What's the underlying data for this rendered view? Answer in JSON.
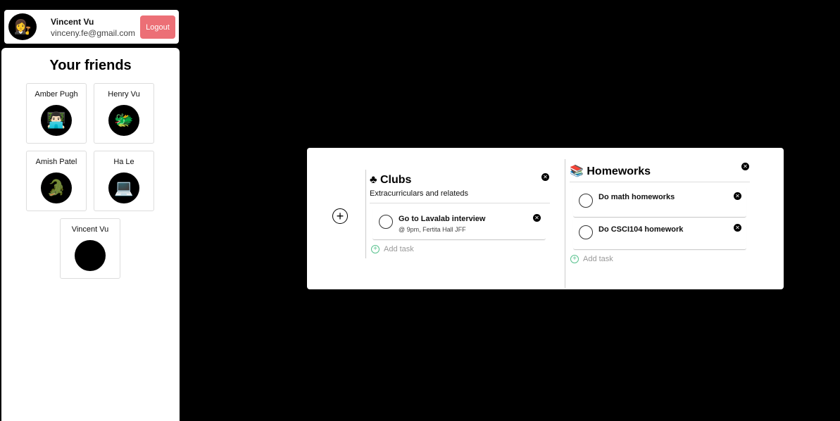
{
  "user": {
    "name": "Vincent Vu",
    "email": "vinceny.fe@gmail.com",
    "avatar": "👩‍⚖️",
    "logout_label": "Logout"
  },
  "friends": {
    "title": "Your friends",
    "items": [
      {
        "name": "Amber Pugh",
        "avatar": "👨🏻‍💻"
      },
      {
        "name": "Henry Vu",
        "avatar": "🐲"
      },
      {
        "name": "Amish Patel",
        "avatar": "🐊"
      },
      {
        "name": "Ha Le",
        "avatar": "💻"
      },
      {
        "name": "Vincent Vu",
        "avatar": "😂"
      }
    ]
  },
  "board": {
    "add_list_icon": "+",
    "lists": [
      {
        "icon": "♣",
        "title": "Clubs",
        "description": "Extracurriculars and relateds",
        "tasks": [
          {
            "title": "Go to Lavalab interview",
            "subtitle": "@ 9pm, Fertita Hall JFF"
          }
        ],
        "add_task_label": "Add task"
      },
      {
        "icon": "📚",
        "title": "Homeworks",
        "description": "",
        "tasks": [
          {
            "title": "Do math homeworks",
            "subtitle": ""
          },
          {
            "title": "Do CSCI104 homework",
            "subtitle": ""
          }
        ],
        "add_task_label": "Add task"
      }
    ]
  },
  "colors": {
    "background": "#000000",
    "logout": "#ec6f76",
    "add_task_accent": "#58c28e"
  }
}
